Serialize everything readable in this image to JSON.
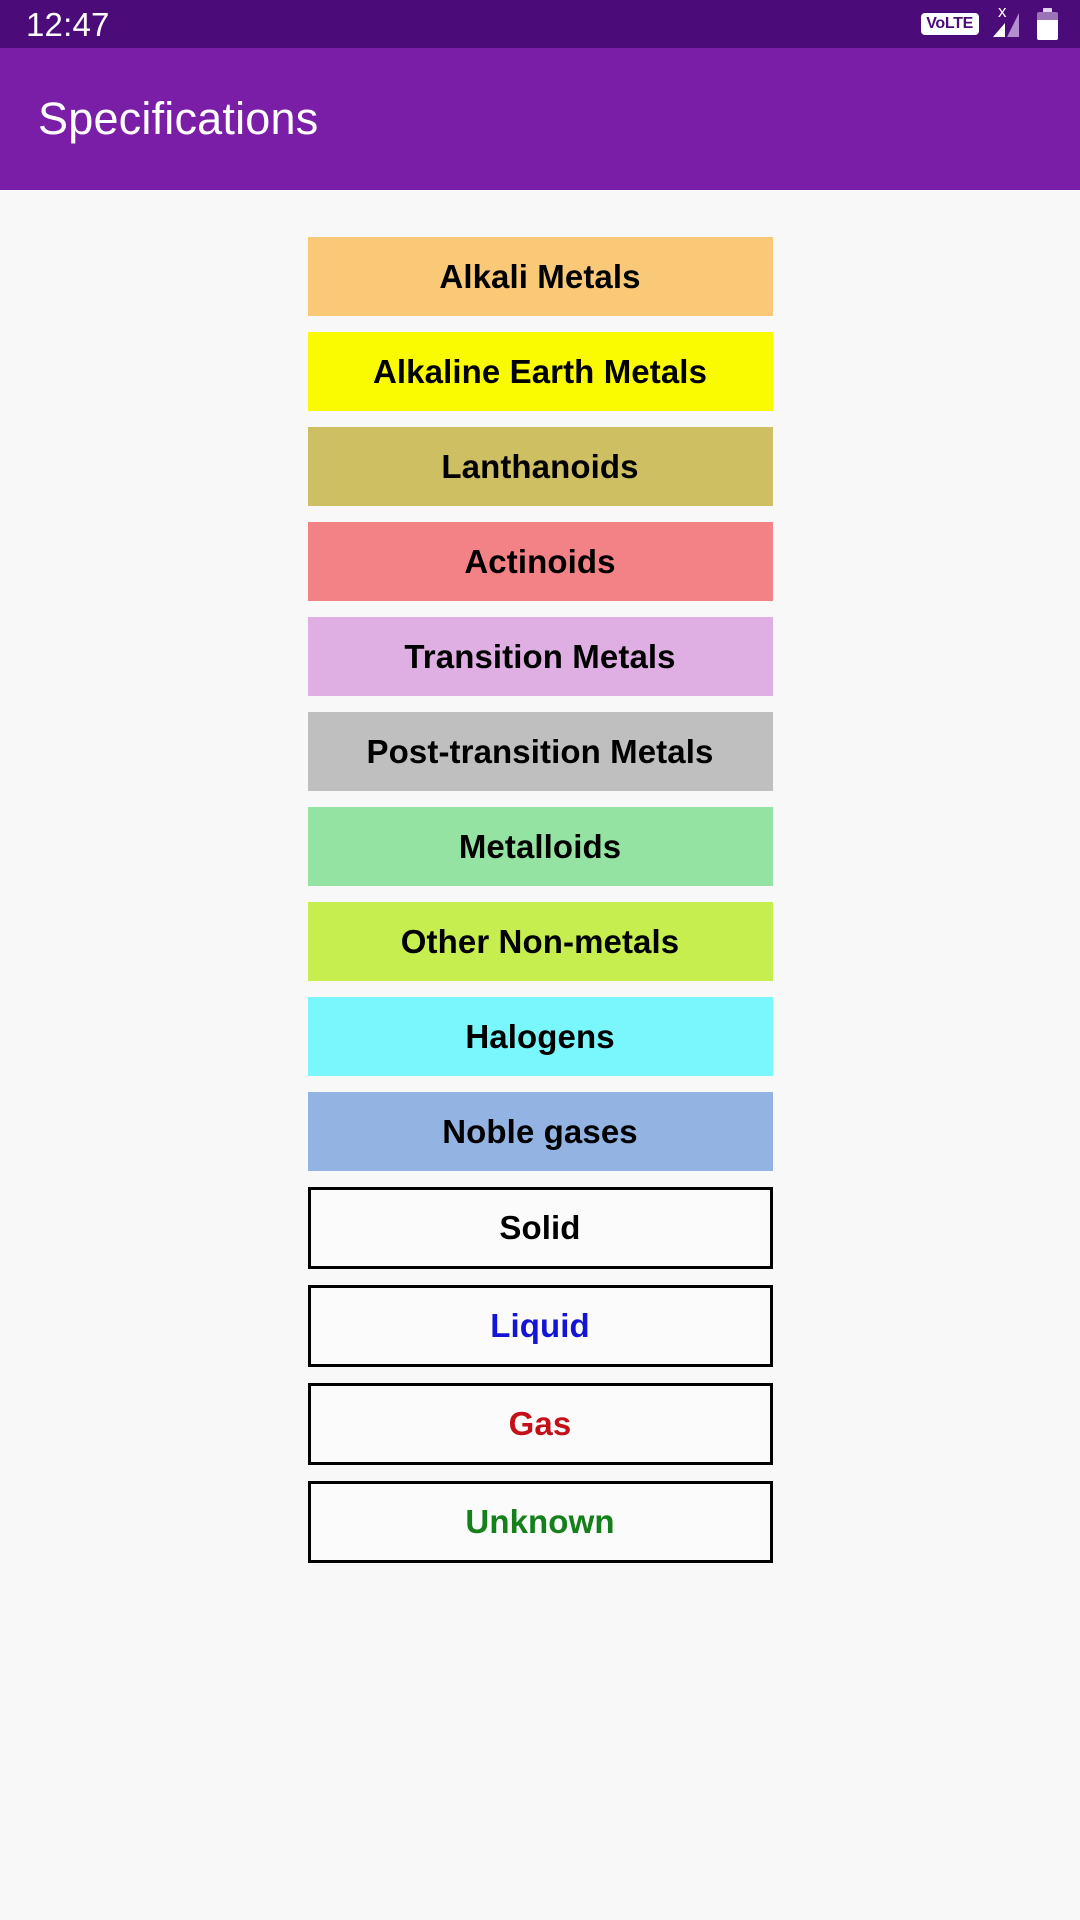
{
  "status_bar": {
    "time": "12:47",
    "volte_label": "VoLTE",
    "signal_icon": "signal-no-service-icon",
    "signal_badge": "x",
    "battery_icon": "battery-icon"
  },
  "app_bar": {
    "title": "Specifications"
  },
  "content": {
    "buttons": [
      {
        "label": "Alkali Metals",
        "bg": "#F9C978",
        "fg": "#000000",
        "style": "filled"
      },
      {
        "label": "Alkaline Earth Metals",
        "bg": "#FAFA00",
        "fg": "#000000",
        "style": "filled"
      },
      {
        "label": "Lanthanoids",
        "bg": "#CEBF62",
        "fg": "#000000",
        "style": "filled"
      },
      {
        "label": "Actinoids",
        "bg": "#F28285",
        "fg": "#000000",
        "style": "filled"
      },
      {
        "label": "Transition Metals",
        "bg": "#DFAEE3",
        "fg": "#000000",
        "style": "filled"
      },
      {
        "label": "Post-transition Metals",
        "bg": "#BFBFBF",
        "fg": "#000000",
        "style": "filled"
      },
      {
        "label": "Metalloids",
        "bg": "#95E3A2",
        "fg": "#000000",
        "style": "filled"
      },
      {
        "label": "Other Non-metals",
        "bg": "#C6EE4E",
        "fg": "#000000",
        "style": "filled"
      },
      {
        "label": "Halogens",
        "bg": "#79F7FC",
        "fg": "#000000",
        "style": "filled"
      },
      {
        "label": "Noble gases",
        "bg": "#93B3E3",
        "fg": "#000000",
        "style": "filled"
      },
      {
        "label": "Solid",
        "bg": "#FBFBFB",
        "fg": "#000000",
        "style": "outlined"
      },
      {
        "label": "Liquid",
        "bg": "#FBFBFB",
        "fg": "#1414D6",
        "style": "outlined"
      },
      {
        "label": "Gas",
        "bg": "#FBFBFB",
        "fg": "#C31019",
        "style": "outlined"
      },
      {
        "label": "Unknown",
        "bg": "#FBFBFB",
        "fg": "#13801A",
        "style": "outlined"
      }
    ]
  },
  "theme": {
    "status_bar_bg": "#4B0B78",
    "app_bar_bg": "#7A1EA8",
    "page_bg": "#F8F8F8",
    "app_bar_fg": "#FFFFFF"
  }
}
